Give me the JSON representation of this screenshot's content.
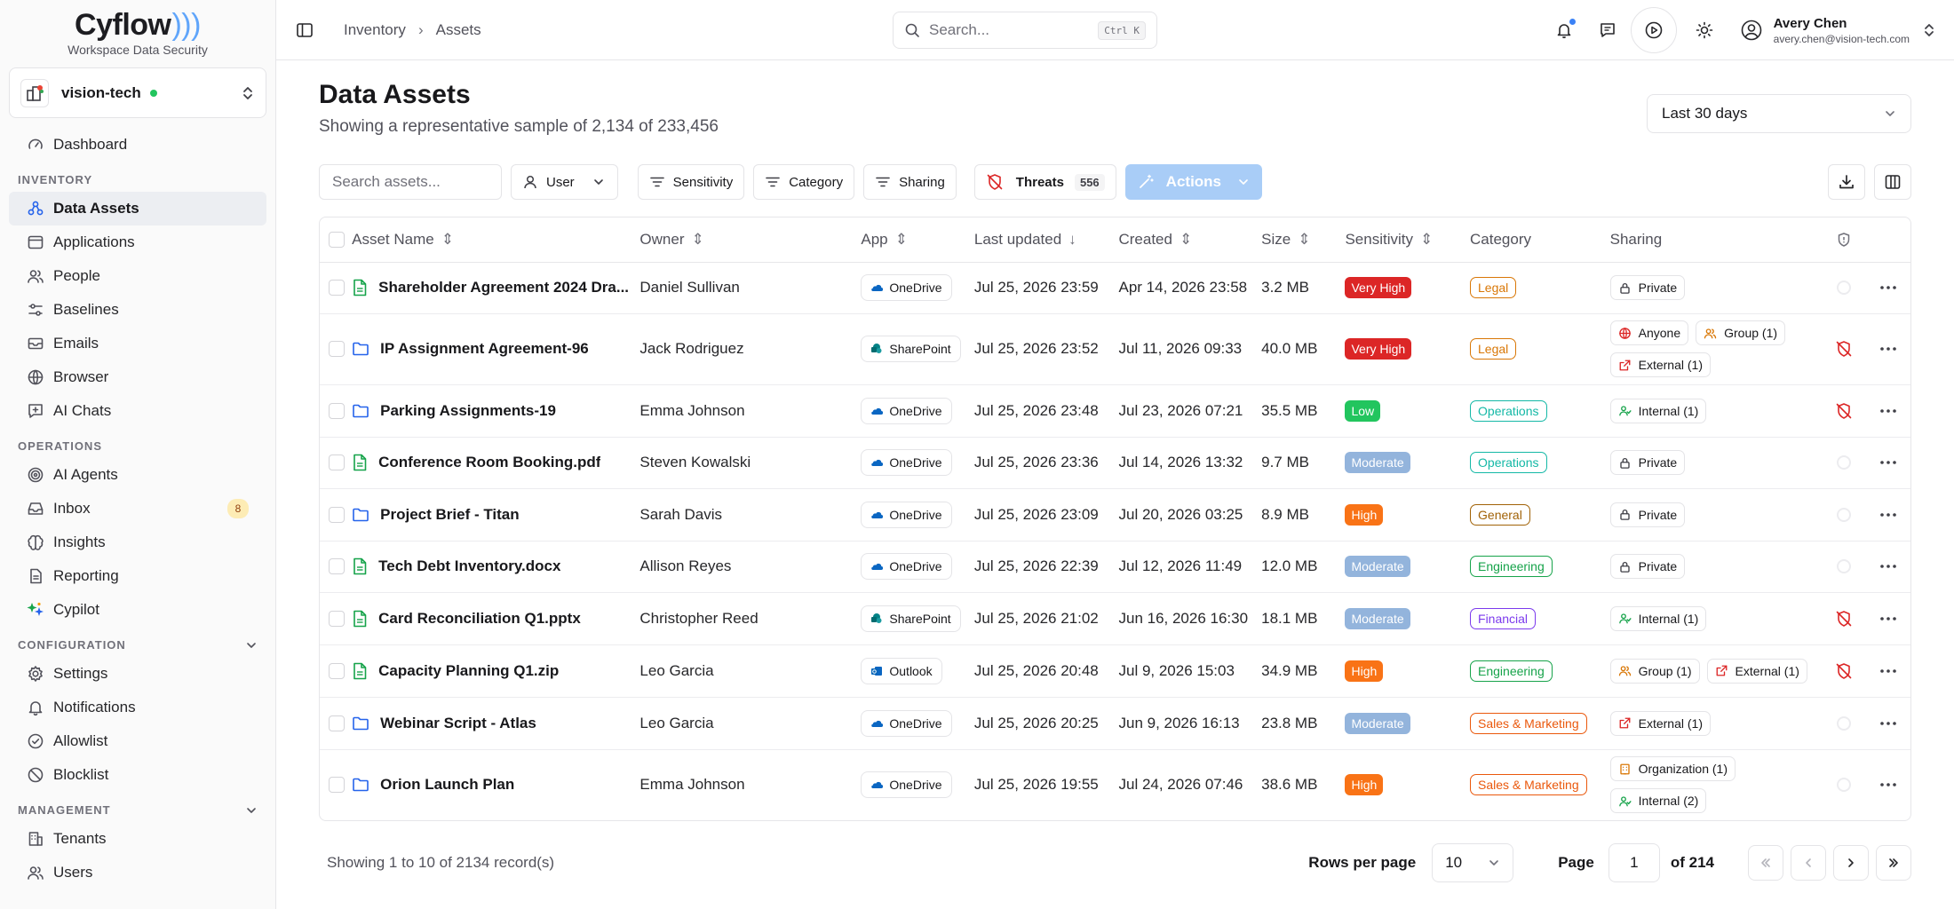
{
  "brand": {
    "name": "Cyflow",
    "subtitle": "Workspace Data Security"
  },
  "tenant": {
    "name": "vision-tech",
    "status_color": "#22c55e"
  },
  "sidebar": {
    "top": [
      {
        "label": "Dashboard",
        "icon": "gauge-icon"
      }
    ],
    "sections": [
      {
        "title": "INVENTORY",
        "items": [
          {
            "label": "Data Assets",
            "icon": "data-assets-icon",
            "active": true
          },
          {
            "label": "Applications",
            "icon": "app-window-icon"
          },
          {
            "label": "People",
            "icon": "users-icon"
          },
          {
            "label": "Baselines",
            "icon": "sliders-icon"
          },
          {
            "label": "Emails",
            "icon": "mail-icon"
          },
          {
            "label": "Browser",
            "icon": "globe-icon"
          },
          {
            "label": "AI Chats",
            "icon": "chat-icon"
          }
        ]
      },
      {
        "title": "OPERATIONS",
        "items": [
          {
            "label": "AI Agents",
            "icon": "target-icon"
          },
          {
            "label": "Inbox",
            "icon": "inbox-icon",
            "badge": "8"
          },
          {
            "label": "Insights",
            "icon": "brain-icon"
          },
          {
            "label": "Reporting",
            "icon": "report-icon"
          },
          {
            "label": "Cypilot",
            "icon": "sparkle-icon"
          }
        ]
      },
      {
        "title": "CONFIGURATION",
        "collapsible": true,
        "items": [
          {
            "label": "Settings",
            "icon": "gear-icon"
          },
          {
            "label": "Notifications",
            "icon": "bell-icon"
          },
          {
            "label": "Allowlist",
            "icon": "check-circle-icon"
          },
          {
            "label": "Blocklist",
            "icon": "ban-icon"
          }
        ]
      },
      {
        "title": "MANAGEMENT",
        "collapsible": true,
        "items": [
          {
            "label": "Tenants",
            "icon": "building-icon"
          },
          {
            "label": "Users",
            "icon": "users-icon"
          }
        ]
      }
    ]
  },
  "topbar": {
    "breadcrumb": [
      "Inventory",
      "Assets"
    ],
    "search_placeholder": "Search...",
    "search_shortcut": "Ctrl K",
    "user": {
      "name": "Avery Chen",
      "email": "avery.chen@vision-tech.com"
    }
  },
  "page": {
    "title": "Data Assets",
    "subtitle": "Showing a representative sample of 2,134 of 233,456",
    "date_range": "Last 30 days"
  },
  "filters": {
    "search_placeholder": "Search assets...",
    "user": "User",
    "sensitivity": "Sensitivity",
    "category": "Category",
    "sharing": "Sharing",
    "threats": "Threats",
    "threats_count": "556",
    "actions": "Actions"
  },
  "table": {
    "columns": [
      "Asset Name",
      "Owner",
      "App",
      "Last updated",
      "Created",
      "Size",
      "Sensitivity",
      "Category",
      "Sharing"
    ],
    "rows": [
      {
        "name": "Shareholder Agreement 2024 Dra...",
        "type": "file",
        "owner": "Daniel Sullivan",
        "app": "OneDrive",
        "updated": "Jul 25, 2026 23:59",
        "created": "Apr 14, 2026 23:58",
        "size": "3.2 MB",
        "sensitivity": "Very High",
        "category": "Legal",
        "sharing": [
          {
            "label": "Private",
            "icon": "lock-icon"
          }
        ],
        "threat": false
      },
      {
        "name": "IP Assignment Agreement-96",
        "type": "folder",
        "owner": "Jack Rodriguez",
        "app": "SharePoint",
        "updated": "Jul 25, 2026 23:52",
        "created": "Jul 11, 2026 09:33",
        "size": "40.0 MB",
        "sensitivity": "Very High",
        "category": "Legal",
        "sharing": [
          {
            "label": "Anyone",
            "icon": "globe-icon"
          },
          {
            "label": "Group (1)",
            "icon": "group-icon"
          },
          {
            "label": "External (1)",
            "icon": "external-icon"
          }
        ],
        "threat": true
      },
      {
        "name": "Parking Assignments-19",
        "type": "folder",
        "owner": "Emma Johnson",
        "app": "OneDrive",
        "updated": "Jul 25, 2026 23:48",
        "created": "Jul 23, 2026 07:21",
        "size": "35.5 MB",
        "sensitivity": "Low",
        "category": "Operations",
        "sharing": [
          {
            "label": "Internal (1)",
            "icon": "internal-icon"
          }
        ],
        "threat": true
      },
      {
        "name": "Conference Room Booking.pdf",
        "type": "file",
        "owner": "Steven Kowalski",
        "app": "OneDrive",
        "updated": "Jul 25, 2026 23:36",
        "created": "Jul 14, 2026 13:32",
        "size": "9.7 MB",
        "sensitivity": "Moderate",
        "category": "Operations",
        "sharing": [
          {
            "label": "Private",
            "icon": "lock-icon"
          }
        ],
        "threat": false
      },
      {
        "name": "Project Brief - Titan",
        "type": "folder",
        "owner": "Sarah Davis",
        "app": "OneDrive",
        "updated": "Jul 25, 2026 23:09",
        "created": "Jul 20, 2026 03:25",
        "size": "8.9 MB",
        "sensitivity": "High",
        "category": "General",
        "sharing": [
          {
            "label": "Private",
            "icon": "lock-icon"
          }
        ],
        "threat": false
      },
      {
        "name": "Tech Debt Inventory.docx",
        "type": "file",
        "owner": "Allison Reyes",
        "app": "OneDrive",
        "updated": "Jul 25, 2026 22:39",
        "created": "Jul 12, 2026 11:49",
        "size": "12.0 MB",
        "sensitivity": "Moderate",
        "category": "Engineering",
        "sharing": [
          {
            "label": "Private",
            "icon": "lock-icon"
          }
        ],
        "threat": false
      },
      {
        "name": "Card Reconciliation Q1.pptx",
        "type": "file",
        "owner": "Christopher Reed",
        "app": "SharePoint",
        "updated": "Jul 25, 2026 21:02",
        "created": "Jun 16, 2026 16:30",
        "size": "18.1 MB",
        "sensitivity": "Moderate",
        "category": "Financial",
        "sharing": [
          {
            "label": "Internal (1)",
            "icon": "internal-icon"
          }
        ],
        "threat": true
      },
      {
        "name": "Capacity Planning Q1.zip",
        "type": "file",
        "owner": "Leo Garcia",
        "app": "Outlook",
        "updated": "Jul 25, 2026 20:48",
        "created": "Jul 9, 2026 15:03",
        "size": "34.9 MB",
        "sensitivity": "High",
        "category": "Engineering",
        "sharing": [
          {
            "label": "Group (1)",
            "icon": "group-icon"
          },
          {
            "label": "External (1)",
            "icon": "external-icon"
          }
        ],
        "threat": true
      },
      {
        "name": "Webinar Script - Atlas",
        "type": "folder",
        "owner": "Leo Garcia",
        "app": "OneDrive",
        "updated": "Jul 25, 2026 20:25",
        "created": "Jun 9, 2026 16:13",
        "size": "23.8 MB",
        "sensitivity": "Moderate",
        "category": "Sales & Marketing",
        "sharing": [
          {
            "label": "External (1)",
            "icon": "external-icon"
          }
        ],
        "threat": false
      },
      {
        "name": "Orion Launch Plan",
        "type": "folder",
        "owner": "Emma Johnson",
        "app": "OneDrive",
        "updated": "Jul 25, 2026 19:55",
        "created": "Jul 24, 2026 07:46",
        "size": "38.6 MB",
        "sensitivity": "High",
        "category": "Sales & Marketing",
        "sharing": [
          {
            "label": "Organization (1)",
            "icon": "building-icon"
          },
          {
            "label": "Internal (2)",
            "icon": "internal-icon"
          }
        ],
        "threat": false
      }
    ]
  },
  "colors": {
    "sensitivity": {
      "Very High": "#dc2626",
      "High": "#f97316",
      "Moderate": "#93b4dc",
      "Low": "#22c55e"
    },
    "category": {
      "Legal": "#d97706",
      "Operations": "#14b8a6",
      "General": "#a16207",
      "Engineering": "#16a34a",
      "Financial": "#7c3aed",
      "Sales & Marketing": "#ea580c"
    }
  },
  "footer": {
    "showing": "Showing 1 to 10 of 2134 record(s)",
    "rows_per_page_label": "Rows per page",
    "rows_per_page": "10",
    "page_label": "Page",
    "page": "1",
    "of_pages": "of 214"
  }
}
